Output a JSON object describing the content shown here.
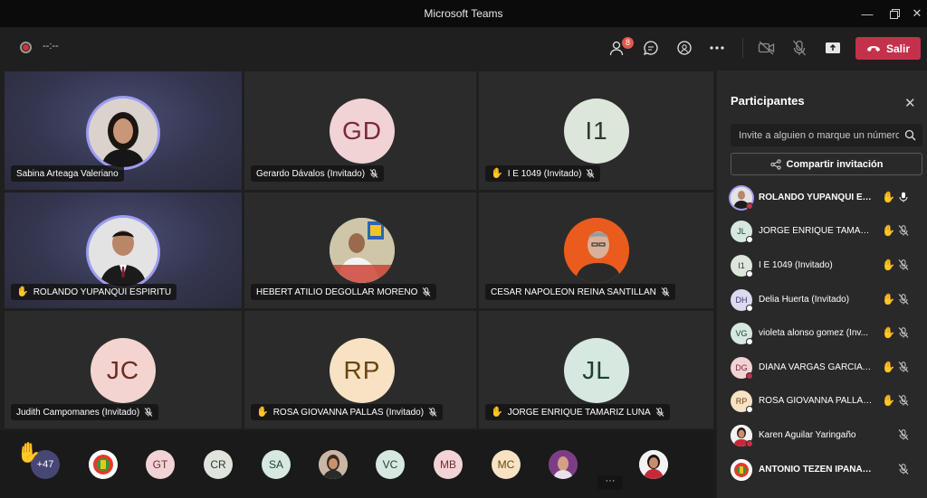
{
  "window": {
    "title": "Microsoft Teams"
  },
  "toolbar": {
    "timer": "--:--",
    "participants_badge": "8",
    "leave_label": "Salir"
  },
  "tiles": [
    {
      "name": "Sabina Arteaga Valeriano",
      "initials": "",
      "hand": false,
      "muted": false
    },
    {
      "name": "Gerardo Dávalos (Invitado)",
      "initials": "GD",
      "hand": false,
      "muted": true
    },
    {
      "name": "I E 1049 (Invitado)",
      "initials": "I1",
      "hand": true,
      "muted": true
    },
    {
      "name": "ROLANDO YUPANQUI ESPIRITU",
      "initials": "",
      "hand": true,
      "muted": false
    },
    {
      "name": "HEBERT ATILIO DEGOLLAR MORENO",
      "initials": "",
      "hand": false,
      "muted": true
    },
    {
      "name": "CESAR NAPOLEON REINA SANTILLAN",
      "initials": "",
      "hand": false,
      "muted": true
    },
    {
      "name": "Judith Campomanes (Invitado)",
      "initials": "JC",
      "hand": false,
      "muted": true
    },
    {
      "name": "ROSA GIOVANNA PALLAS (Invitado)",
      "initials": "RP",
      "hand": true,
      "muted": true
    },
    {
      "name": "JORGE ENRIQUE TAMARIZ LUNA",
      "initials": "JL",
      "hand": true,
      "muted": true
    }
  ],
  "strip": {
    "overflow_count": "+47",
    "avatars": [
      "",
      "GT",
      "CR",
      "SA",
      "",
      "VC",
      "MB",
      "MC",
      "",
      ""
    ],
    "more_label": "···"
  },
  "panel": {
    "title": "Participantes",
    "invite_placeholder": "Invite a alguien o marque un número",
    "share_label": "Compartir invitación",
    "participants": [
      {
        "name": "ROLANDO YUPANQUI ES...",
        "initials": "",
        "hand": true,
        "muted": false
      },
      {
        "name": "JORGE ENRIQUE TAMARI...",
        "initials": "JL",
        "hand": true,
        "muted": true
      },
      {
        "name": "I E 1049 (Invitado)",
        "initials": "I1",
        "hand": true,
        "muted": true
      },
      {
        "name": "Delia Huerta (Invitado)",
        "initials": "DH",
        "hand": true,
        "muted": true
      },
      {
        "name": "violeta alonso gomez (Inv...",
        "initials": "VG",
        "hand": true,
        "muted": true
      },
      {
        "name": "DIANA VARGAS GARCIA (...",
        "initials": "DG",
        "hand": true,
        "muted": true
      },
      {
        "name": "ROSA GIOVANNA PALLAS...",
        "initials": "RP",
        "hand": true,
        "muted": true
      },
      {
        "name": "Karen Aguilar Yaringaño",
        "initials": "",
        "hand": false,
        "muted": true
      },
      {
        "name": "ANTONIO TEZEN IPANAQUE",
        "initials": "",
        "hand": false,
        "muted": true
      }
    ]
  },
  "colors": {
    "accent": "#6264a7",
    "leave": "#c4314b",
    "speaking_ring": "#9d9cf2",
    "avatar_gd": "#f1d3d6",
    "avatar_i1": "#dde6da",
    "avatar_jc": "#f3d4d0",
    "avatar_rp": "#f7e2c4",
    "avatar_jl": "#d6e8df"
  }
}
